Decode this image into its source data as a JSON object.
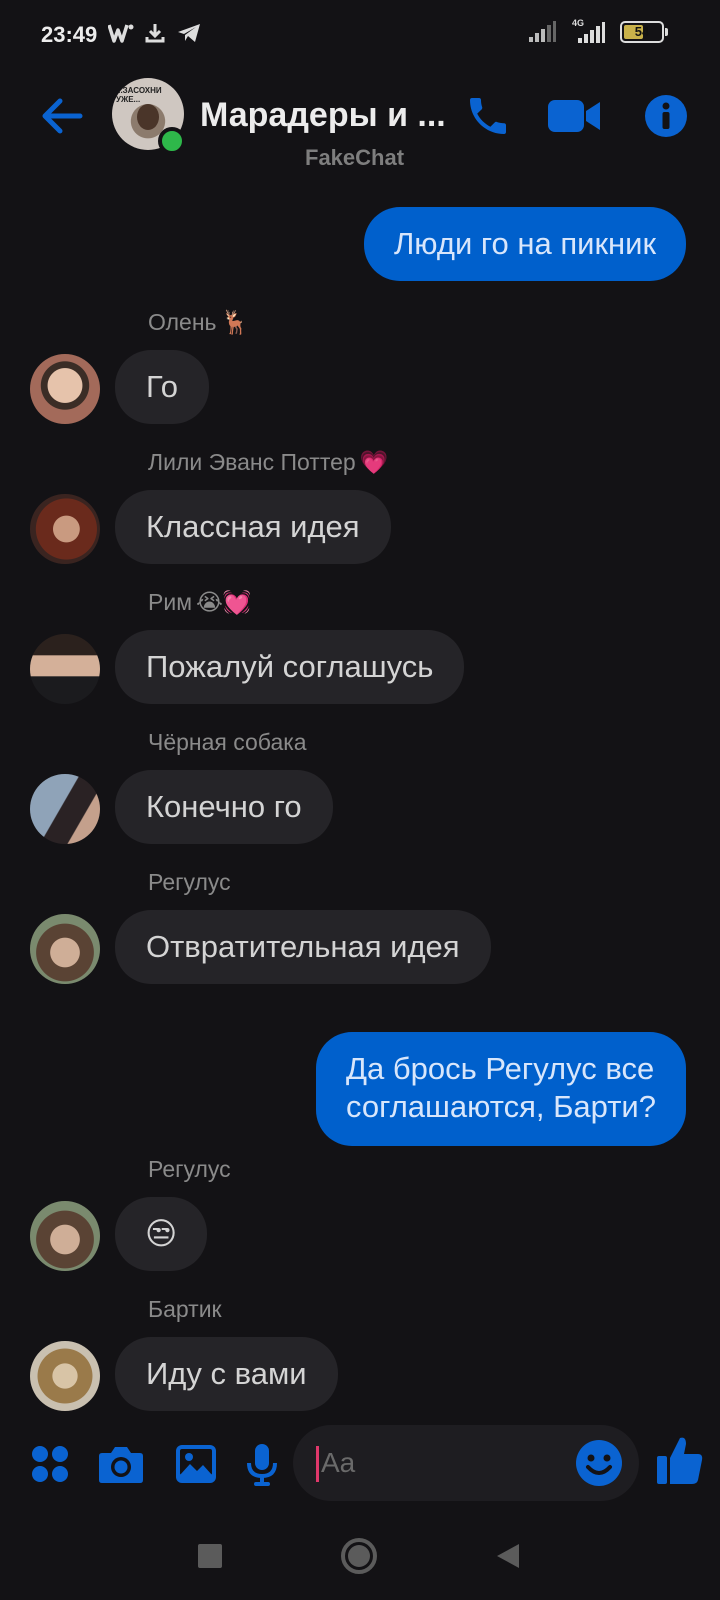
{
  "status_bar": {
    "time": "23:49",
    "network_label": "4G",
    "battery": "54"
  },
  "header": {
    "title": "Марадеры и ...",
    "subtitle": "FakeChat",
    "avatar_caption_1": "...ЗАСОХНИ",
    "avatar_caption_2": "УЖЕ..."
  },
  "messages": [
    {
      "type": "outgoing",
      "text": "Люди го на пикник"
    },
    {
      "type": "incoming",
      "sender": "Олень",
      "sender_emoji": "🦌",
      "text": "Го"
    },
    {
      "type": "incoming",
      "sender": "Лили Эванс Поттер",
      "sender_emoji": "💗",
      "text": "Классная идея"
    },
    {
      "type": "incoming",
      "sender": "Рим",
      "sender_emoji": "😭💓",
      "text": "Пожалуй соглашусь"
    },
    {
      "type": "incoming",
      "sender": "Чёрная собака",
      "sender_emoji": "",
      "text": "Конечно го"
    },
    {
      "type": "incoming",
      "sender": "Регулус",
      "sender_emoji": "",
      "text": "Отвратительная идея"
    },
    {
      "type": "outgoing",
      "text_line1": "Да брось Регулус все",
      "text_line2": "соглашаются, Барти?"
    },
    {
      "type": "incoming",
      "sender": "Регулус",
      "sender_emoji": "",
      "text": "😒"
    },
    {
      "type": "incoming",
      "sender": "Бартик",
      "sender_emoji": "",
      "text": "Иду с вами"
    }
  ],
  "composer": {
    "placeholder": "Aa"
  },
  "colors": {
    "accent": "#0a63d1",
    "background": "#131215",
    "incoming_bubble": "#252428",
    "outgoing_bubble": "#0060cc",
    "online": "#2eb84a"
  },
  "icons": {
    "back": "arrow-left-icon",
    "call": "phone-icon",
    "video": "video-camera-icon",
    "info": "info-icon",
    "menu": "grid-dots-icon",
    "camera": "camera-icon",
    "gallery": "image-icon",
    "voice": "microphone-icon",
    "emoji": "smiley-icon",
    "like": "thumbs-up-icon"
  }
}
